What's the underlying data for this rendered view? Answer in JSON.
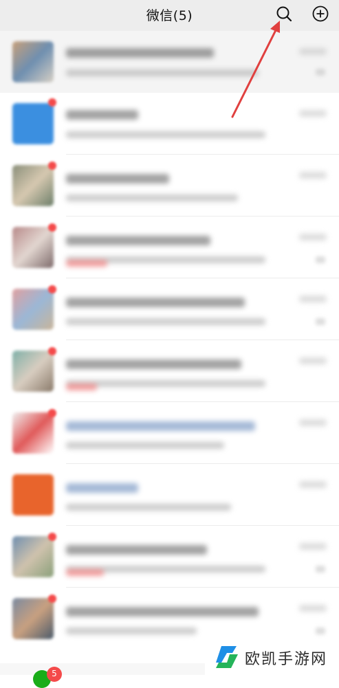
{
  "header": {
    "title": "微信(5)",
    "search_icon": "search-icon",
    "add_icon": "plus-circle-icon"
  },
  "tabbar": {
    "chats_badge": "5"
  },
  "watermark": {
    "text": "欧凯手游网"
  },
  "colors": {
    "header_bg": "#ededed",
    "arrow": "#e0403f",
    "badge": "#f44a4a",
    "pinned_row_bg": "#f4f4f4",
    "wechat_green": "#1aad19"
  }
}
